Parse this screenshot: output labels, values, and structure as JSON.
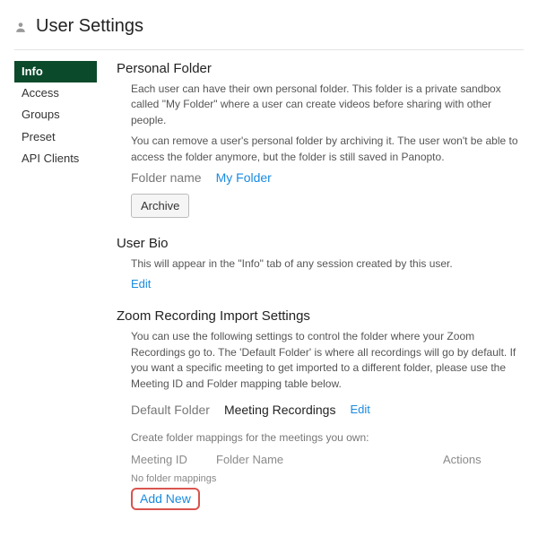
{
  "header": {
    "title": "User Settings"
  },
  "sidebar": {
    "items": [
      {
        "label": "Info",
        "active": true
      },
      {
        "label": "Access",
        "active": false
      },
      {
        "label": "Groups",
        "active": false
      },
      {
        "label": "Preset",
        "active": false
      },
      {
        "label": "API Clients",
        "active": false
      }
    ]
  },
  "personal_folder": {
    "title": "Personal Folder",
    "desc1": "Each user can have their own personal folder. This folder is a private sandbox called \"My Folder\" where a user can create videos before sharing with other people.",
    "desc2": "You can remove a user's personal folder by archiving it. The user won't be able to access the folder anymore, but the folder is still saved in Panopto.",
    "field_label": "Folder name",
    "field_value": "My Folder",
    "archive_label": "Archive"
  },
  "user_bio": {
    "title": "User Bio",
    "desc": "This will appear in the \"Info\" tab of any session created by this user.",
    "edit_label": "Edit"
  },
  "zoom": {
    "title": "Zoom Recording Import Settings",
    "desc": "You can use the following settings to control the folder where your Zoom Recordings go to. The 'Default Folder' is where all recordings will go by default. If you want a specific meeting to get imported to a different folder, please use the Meeting ID and Folder mapping table below.",
    "default_folder_label": "Default Folder",
    "default_folder_value": "Meeting Recordings",
    "edit_label": "Edit",
    "mapping_hint": "Create folder mappings for the meetings you own:",
    "col_id": "Meeting ID",
    "col_name": "Folder Name",
    "col_actions": "Actions",
    "empty": "No folder mappings",
    "add_new": "Add New"
  }
}
